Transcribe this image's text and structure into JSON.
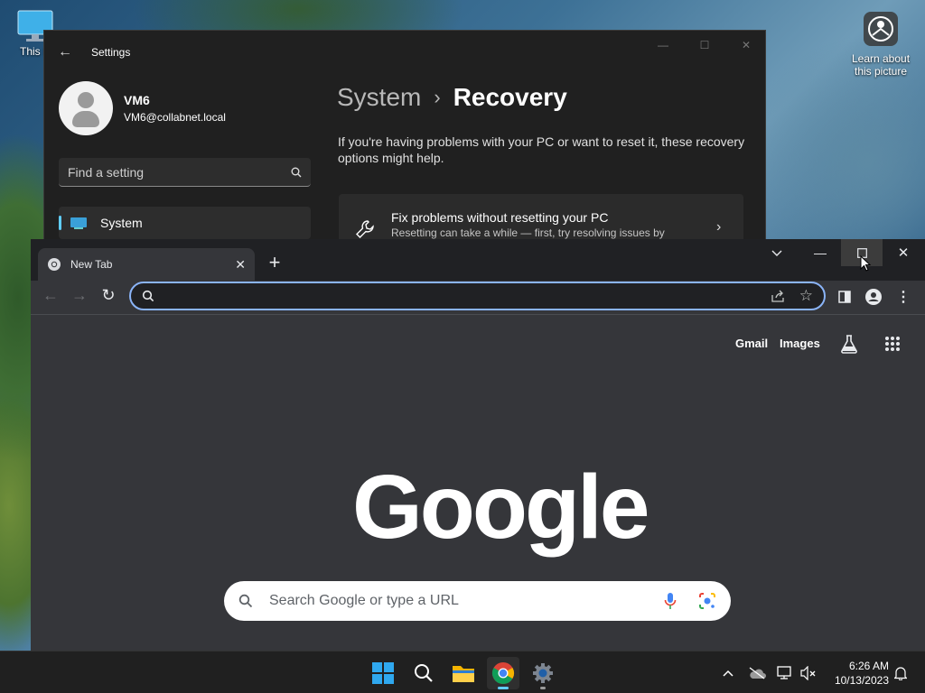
{
  "desktop": {
    "this_pc_label": "This P",
    "learn_label_1": "Learn about",
    "learn_label_2": "this picture"
  },
  "settings": {
    "title": "Settings",
    "user_name": "VM6",
    "user_email": "VM6@collabnet.local",
    "search_placeholder": "Find a setting",
    "nav_system": "System",
    "breadcrumb_parent": "System",
    "breadcrumb_sep": "›",
    "breadcrumb_current": "Recovery",
    "description": "If you're having problems with your PC or want to reset it, these recovery options might help.",
    "fix_title": "Fix problems without resetting your PC",
    "fix_subtitle": "Resetting can take a while — first, try resolving issues by"
  },
  "chrome": {
    "tab_title": "New Tab",
    "omnibox_value": "",
    "link_gmail": "Gmail",
    "link_images": "Images",
    "logo_text": "Google",
    "search_placeholder": "Search Google or type a URL"
  },
  "taskbar": {
    "time": "6:26 AM",
    "date": "10/13/2023"
  },
  "colors": {
    "accent": "#8ab4f8",
    "settings_accent": "#60cdff",
    "taskbar_bg": "#202020"
  }
}
